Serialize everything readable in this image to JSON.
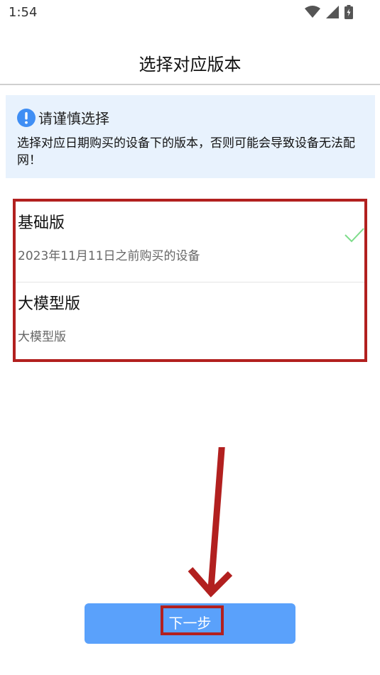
{
  "status": {
    "time": "1:54"
  },
  "header": {
    "title": "选择对应版本"
  },
  "notice": {
    "title": "请谨慎选择",
    "description": "选择对应日期购买的设备下的版本，否则可能会导致设备无法配网！"
  },
  "options": [
    {
      "title": "基础版",
      "subtitle": "2023年11月11日之前购买的设备",
      "selected": true
    },
    {
      "title": "大模型版",
      "subtitle": "大模型版",
      "selected": false
    }
  ],
  "footer": {
    "next_label": "下一步"
  },
  "colors": {
    "accent": "#5aa1fb",
    "highlight": "#b2201f",
    "notice_bg": "#e8f2fd",
    "check": "#7ddc8a"
  }
}
